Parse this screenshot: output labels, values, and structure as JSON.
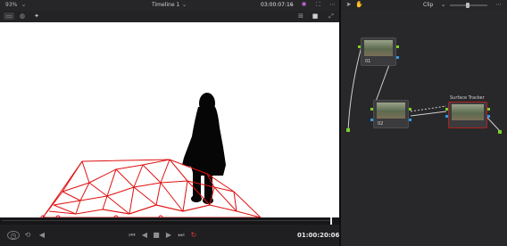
{
  "viewer": {
    "zoom": "93%",
    "title": "Timeline 1",
    "timecode": "03:00:07:16"
  },
  "transport": {
    "timecode": "01:00:20:06"
  },
  "node_editor": {
    "mode": "Clip",
    "nodes": [
      {
        "label": "01"
      },
      {
        "label": "02"
      },
      {
        "label": "Surface Tracker"
      }
    ]
  },
  "colors": {
    "mesh": "#e01010",
    "record": "#e03a2a",
    "node_selected": "#b02020",
    "connector": "#cfcfcf"
  }
}
